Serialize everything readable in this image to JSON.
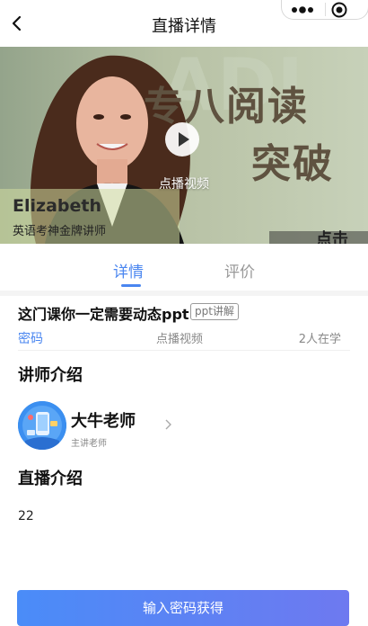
{
  "header": {
    "title": "直播详情"
  },
  "video": {
    "play_label": "点播视频",
    "banner_line1": "专八阅读",
    "banner_line2": "突破",
    "teacher_name": "Elizabeth",
    "teacher_subtitle": "英语考神金牌讲师",
    "corner_text": "点击"
  },
  "tabs": [
    {
      "label": "详情",
      "active": true
    },
    {
      "label": "评价",
      "active": false
    }
  ],
  "course": {
    "title": "这门课你一定需要动态ppt",
    "tag": "ppt讲解",
    "password_label": "密码",
    "type_label": "点播视频",
    "learners": "2人在学"
  },
  "lecturer_section": {
    "title": "讲师介绍",
    "name": "大牛老师",
    "role": "主讲老师"
  },
  "live_section": {
    "title": "直播介绍",
    "content": "22"
  },
  "cta": {
    "label": "输入密码获得"
  },
  "colors": {
    "accent": "#4a86f0",
    "cta_start": "#4a8cf8",
    "cta_end": "#6e79f0"
  }
}
